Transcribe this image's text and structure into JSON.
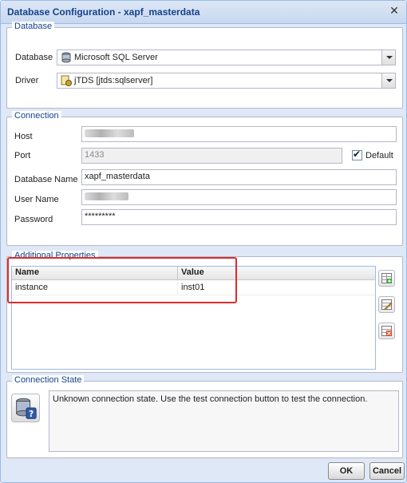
{
  "dialog": {
    "title": "Database Configuration - xapf_masterdata",
    "close_icon": "close-icon"
  },
  "database_section": {
    "legend": "Database",
    "database_label": "Database",
    "database_value": "Microsoft SQL Server",
    "database_icon": "database-icon",
    "driver_label": "Driver",
    "driver_value": "jTDS [jtds:sqlserver]",
    "driver_icon": "driver-icon"
  },
  "connection_section": {
    "legend": "Connection",
    "host_label": "Host",
    "port_label": "Port",
    "port_value": "1433",
    "default_label": "Default",
    "dbname_label": "Database Name",
    "dbname_value": "xapf_masterdata",
    "user_label": "User Name",
    "password_label": "Password",
    "password_value": "*********"
  },
  "additional_properties": {
    "legend": "Additional Properties",
    "columns": [
      "Name",
      "Value"
    ],
    "rows": [
      {
        "name": "instance",
        "value": "inst01"
      }
    ],
    "tools": [
      "add-row-icon",
      "edit-row-icon",
      "delete-row-icon"
    ]
  },
  "connection_state": {
    "legend": "Connection State",
    "message": "Unknown connection state. Use the test connection button to test the connection.",
    "icon": "database-unknown-icon"
  },
  "footer": {
    "ok_label": "OK",
    "cancel_label": "Cancel"
  },
  "colors": {
    "title_text": "#15428b",
    "accent_border": "#99bbe8",
    "highlight": "#d92d2d"
  }
}
